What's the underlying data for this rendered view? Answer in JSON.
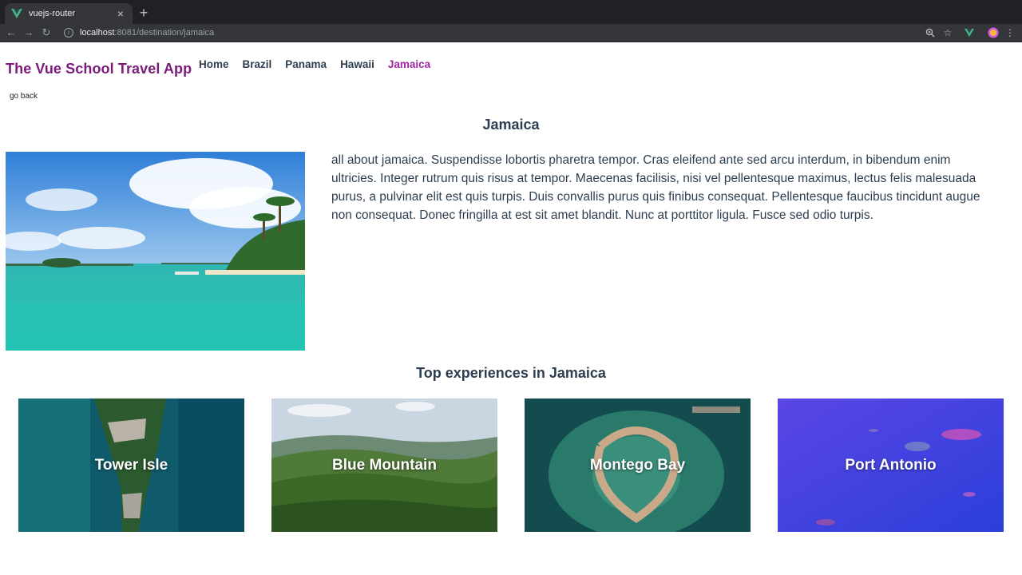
{
  "browser": {
    "tab_title": "vuejs-router",
    "url_host": "localhost",
    "url_rest": ":8081/destination/jamaica"
  },
  "app": {
    "brand": "The Vue School Travel App",
    "nav": [
      {
        "label": "Home",
        "active": false
      },
      {
        "label": "Brazil",
        "active": false
      },
      {
        "label": "Panama",
        "active": false
      },
      {
        "label": "Hawaii",
        "active": false
      },
      {
        "label": "Jamaica",
        "active": true
      }
    ],
    "go_back": "go back"
  },
  "destination": {
    "name": "Jamaica",
    "description": "all about jamaica. Suspendisse lobortis pharetra tempor. Cras eleifend ante sed arcu interdum, in bibendum enim ultricies. Integer rutrum quis risus at tempor. Maecenas facilisis, nisi vel pellentesque maximus, lectus felis malesuada purus, a pulvinar elit est quis turpis. Duis convallis purus quis finibus consequat. Pellentesque faucibus tincidunt augue non consequat. Donec fringilla at est sit amet blandit. Nunc at porttitor ligula. Fusce sed odio turpis."
  },
  "experiences": {
    "heading": "Top experiences in Jamaica",
    "items": [
      {
        "name": "Tower Isle"
      },
      {
        "name": "Blue Mountain"
      },
      {
        "name": "Montego Bay"
      },
      {
        "name": "Port Antonio"
      }
    ]
  },
  "colors": {
    "brand": "#7b1a7b",
    "active_link": "#9c27a0",
    "text": "#2c3e50"
  }
}
